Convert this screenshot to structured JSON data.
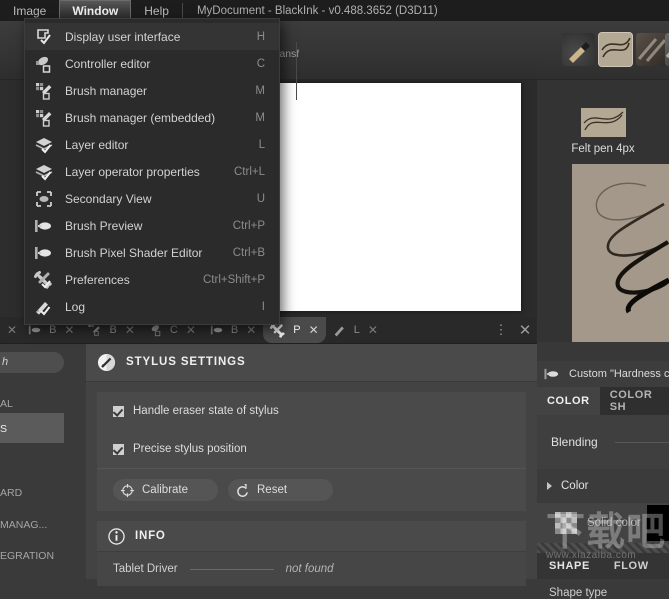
{
  "menubar": {
    "items": [
      {
        "label": "Image",
        "active": false
      },
      {
        "label": "Window",
        "active": true
      },
      {
        "label": "Help",
        "active": false
      }
    ],
    "title": "MyDocument - BlackInk  - v0.488.3652 (D3D11)"
  },
  "window_menu": {
    "items": [
      {
        "label": "Display user interface",
        "shortcut": "H",
        "icon": "display-ui-icon",
        "highlighted": true
      },
      {
        "label": "Controller editor",
        "shortcut": "C",
        "icon": "controller-icon"
      },
      {
        "label": "Brush manager",
        "shortcut": "M",
        "icon": "brush-manager-icon"
      },
      {
        "label": "Brush manager (embedded)",
        "shortcut": "M",
        "icon": "brush-manager-embedded-icon"
      },
      {
        "label": "Layer editor",
        "shortcut": "L",
        "icon": "layers-icon"
      },
      {
        "label": "Layer operator properties",
        "shortcut": "Ctrl+L",
        "icon": "layers-properties-icon"
      },
      {
        "label": "Secondary View",
        "shortcut": "U",
        "icon": "secondary-view-icon"
      },
      {
        "label": "Brush Preview",
        "shortcut": "Ctrl+P",
        "icon": "brush-preview-icon"
      },
      {
        "label": "Brush Pixel Shader Editor",
        "shortcut": "Ctrl+B",
        "icon": "brush-shader-icon"
      },
      {
        "label": "Preferences",
        "shortcut": "Ctrl+Shift+P",
        "icon": "wrench-icon"
      },
      {
        "label": "Log",
        "shortcut": "I",
        "icon": "pencil-icon"
      }
    ]
  },
  "toolbar": {
    "select_transform_label": "Select & Transf",
    "icons": [
      "gradient-tool-icon",
      "zoom-tool-icon",
      "screen-tool-icon",
      "lasso-select-icon",
      "transform-icon"
    ]
  },
  "tabstrip": {
    "tabs": [
      {
        "label": "",
        "icon": "close-icon",
        "closable": false,
        "active": false
      },
      {
        "label": "B",
        "icon": "brush-preview-icon",
        "closable": true,
        "active": false
      },
      {
        "label": "B",
        "icon": "brush-manager-icon",
        "closable": true,
        "active": false
      },
      {
        "label": "C",
        "icon": "controller-icon",
        "closable": true,
        "active": false
      },
      {
        "label": "B",
        "icon": "brush-preview-icon",
        "closable": true,
        "active": false
      },
      {
        "label": "P",
        "icon": "wrench-icon",
        "closable": true,
        "active": true
      },
      {
        "label": "L",
        "icon": "pencil-icon",
        "closable": true,
        "active": false
      }
    ],
    "menu_button": "kebab-menu-icon",
    "close_button": "close-icon"
  },
  "sidebar": {
    "search_value": "h",
    "items": [
      {
        "label": "AL",
        "selected": false
      },
      {
        "label": "S",
        "selected": true
      },
      {
        "label": "ARD",
        "selected": false
      },
      {
        "label": "MANAG...",
        "selected": false
      },
      {
        "label": "EGRATION",
        "selected": false
      }
    ]
  },
  "stylus_settings": {
    "title": "STYLUS SETTINGS",
    "icon": "stylus-icon",
    "options": [
      {
        "label": "Handle eraser state of stylus",
        "checked": true
      },
      {
        "label": "Precise stylus position",
        "checked": true
      }
    ],
    "buttons": [
      {
        "label": "Calibrate",
        "icon": "crosshair-icon"
      },
      {
        "label": "Reset",
        "icon": "reset-icon"
      }
    ]
  },
  "info": {
    "title": "INFO",
    "icon": "info-icon",
    "rows": [
      {
        "key": "Tablet Driver",
        "value": "not found"
      }
    ]
  },
  "right_panel": {
    "brush_thumbnails": [
      {
        "name": "brush-thumb-1",
        "selected": false
      },
      {
        "name": "brush-thumb-2",
        "selected": true
      },
      {
        "name": "brush-thumb-3",
        "selected": false
      },
      {
        "name": "brush-thumb-4",
        "selected": false
      }
    ],
    "brush_name": "Felt pen 4px",
    "brush_row_label": "Custom \"Hardness c",
    "brush_row_icon": "brush-preview-icon",
    "color_tabs": [
      {
        "label": "COLOR",
        "active": true
      },
      {
        "label": "COLOR SH",
        "active": false
      }
    ],
    "blending_label": "Blending",
    "color_label": "Color",
    "solid_color_label": "Solid color",
    "solid_color_value": "#000000",
    "shape_tabs": [
      {
        "label": "SHAPE",
        "active": true
      },
      {
        "label": "FLOW",
        "active": false
      }
    ],
    "shape_type_label": "Shape type"
  },
  "watermark": {
    "text": "下载吧",
    "url": "www.xiazaiba.com"
  },
  "colors": {
    "menu_bg": "#2b2b2b",
    "panel_bg": "#434343",
    "accent_tab": "#4a4a4a",
    "canvas": "#ffffff",
    "brush_preview_bg": "#a3988a"
  }
}
